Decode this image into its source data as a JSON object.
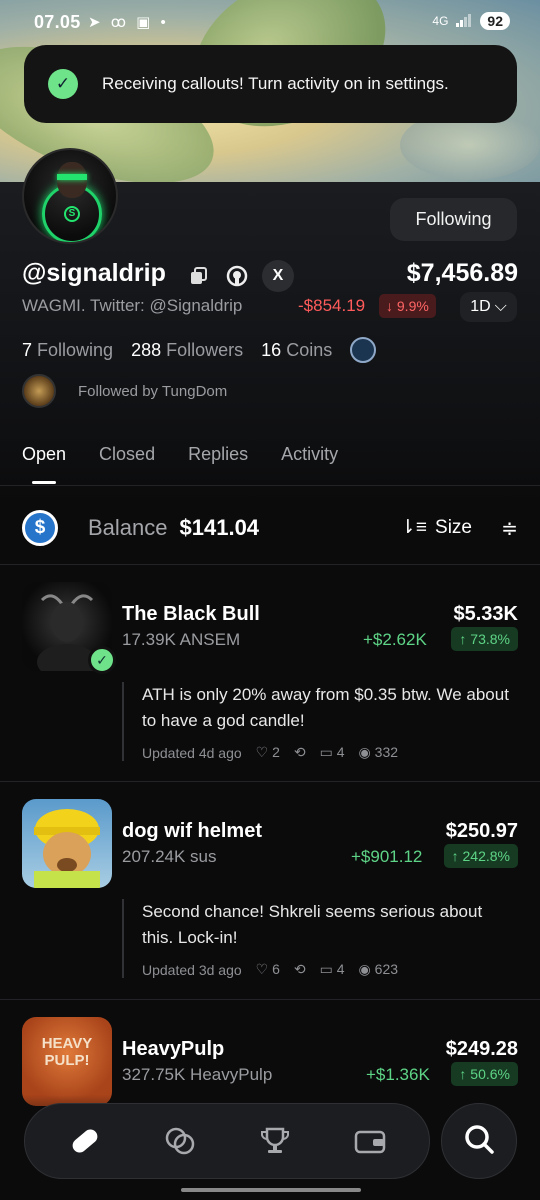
{
  "status_bar": {
    "time": "07.05",
    "icons": "➤ ꝏ ▣ •",
    "network": "4G",
    "battery": "92"
  },
  "toast": {
    "message": "Receiving callouts! Turn activity on in settings."
  },
  "profile": {
    "follow_button": "Following",
    "handle": "@signaldrip",
    "bio": "WAGMI. Twitter: @Signaldrip",
    "x_label": "X",
    "portfolio_value": "$7,456.89",
    "change_value": "-$854.19",
    "change_pct": "↓ 9.9%",
    "period": "1D",
    "stats": {
      "following_count": "7",
      "following_label": "Following",
      "followers_count": "288",
      "followers_label": "Followers",
      "coins_count": "16",
      "coins_label": "Coins"
    },
    "followed_by": "Followed by TungDom"
  },
  "tabs": [
    {
      "label": "Open",
      "active": true
    },
    {
      "label": "Closed",
      "active": false
    },
    {
      "label": "Replies",
      "active": false
    },
    {
      "label": "Activity",
      "active": false
    }
  ],
  "balance": {
    "coin_symbol": "$",
    "label": "Balance",
    "value": "$141.04",
    "sort_label": "Size"
  },
  "positions": [
    {
      "name": "The Black Bull",
      "amount": "17.39K ANSEM",
      "value": "$5.33K",
      "gain": "+$2.62K",
      "gain_pct": "↑ 73.8%",
      "note": "ATH is only 20% away from $0.35 btw. We about to have a god candle!",
      "updated": "Updated 4d ago",
      "likes": "2",
      "replies": "4",
      "views": "332"
    },
    {
      "name": "dog wif helmet",
      "amount": "207.24K sus",
      "value": "$250.97",
      "gain": "+$901.12",
      "gain_pct": "↑ 242.8%",
      "note": "Second chance! Shkreli seems serious about this. Lock-in!",
      "updated": "Updated 3d ago",
      "likes": "6",
      "replies": "4",
      "views": "623"
    },
    {
      "name": "HeavyPulp",
      "amount": "327.75K HeavyPulp",
      "value": "$249.28",
      "gain": "+$1.36K",
      "gain_pct": "↑ 50.6%",
      "thumb_text": "HEAVY PULP!"
    }
  ],
  "colors": {
    "accent_green": "#5ed486",
    "loss_red": "#ff5b5b",
    "background": "#0b0b0c"
  }
}
